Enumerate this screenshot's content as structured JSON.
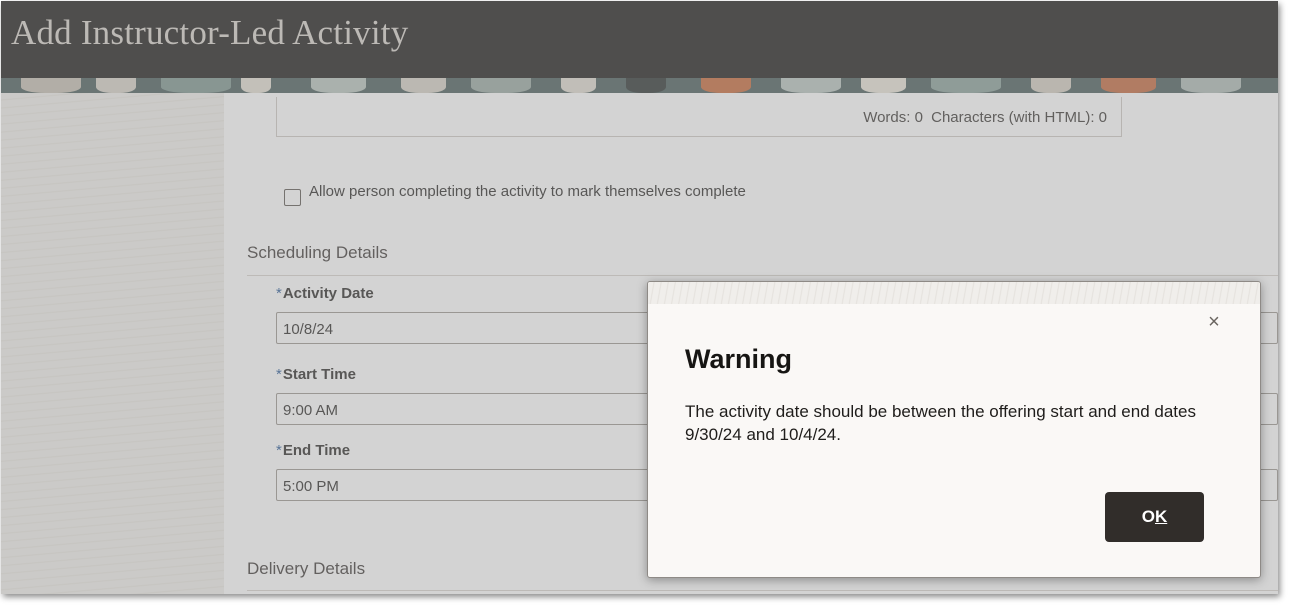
{
  "header": {
    "title": "Add Instructor-Led Activity"
  },
  "editor": {
    "words_label": "Words: 0",
    "characters_label": "Characters (with HTML): 0"
  },
  "self_complete": {
    "label": "Allow person completing the activity to mark themselves complete",
    "checked": false
  },
  "scheduling": {
    "title": "Scheduling Details",
    "required_marker": "*",
    "fields": [
      {
        "label": "Activity Date",
        "value": "10/8/24"
      },
      {
        "label": "Start Time",
        "value": "9:00 AM"
      },
      {
        "label": "End Time",
        "value": "5:00 PM"
      }
    ]
  },
  "delivery": {
    "title": "Delivery Details"
  },
  "dialog": {
    "close_glyph": "×",
    "close_icon": "close-icon",
    "title": "Warning",
    "message": "The activity date should be between the offering start and end dates 9/30/24 and 10/4/24.",
    "ok_first": "O",
    "ok_mnemonic": "K"
  },
  "colors": {
    "header_bg": "#1c1a19",
    "button_bg": "#312d2a",
    "required_marker": "#2c5b97"
  }
}
